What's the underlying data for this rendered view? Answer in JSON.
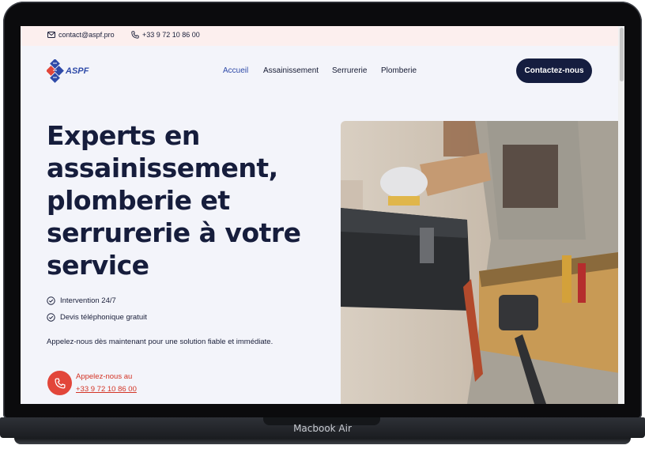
{
  "device": {
    "label": "Macbook Air"
  },
  "topbar": {
    "email": "contact@aspf.pro",
    "phone": "+33 9 72 10 86 00"
  },
  "header": {
    "logo_text": "ASPF",
    "nav": [
      "Accueil",
      "Assainissement",
      "Serrurerie",
      "Plomberie"
    ],
    "cta": "Contactez-nous"
  },
  "hero": {
    "title_lines": [
      "Experts en",
      "assainissement,",
      "plomberie et",
      "serrurerie à votre",
      "service"
    ],
    "bullets": [
      "Intervention 24/7",
      "Devis téléphonique gratuit"
    ],
    "paragraph": "Appelez-nous dès maintenant pour une solution fiable et immédiate.",
    "call_label": "Appelez-nous au",
    "call_number": "+33 9 72 10 86 00"
  },
  "colors": {
    "navy": "#151d3f",
    "accent_blue": "#2e4aa8",
    "red": "#e2463a",
    "topbar_bg": "#fcefee",
    "page_bg": "#f3f4fa"
  },
  "icons": [
    "mail-icon",
    "phone-icon",
    "logo-icon",
    "check-circle-icon",
    "phone-call-icon"
  ]
}
